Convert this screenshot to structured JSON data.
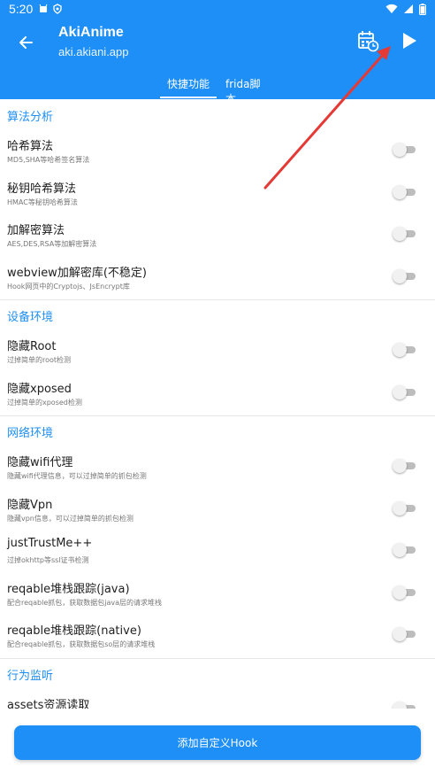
{
  "status_bar": {
    "time": "5:20"
  },
  "app_bar": {
    "title": "AkiAnime",
    "subtitle": "aki.akiani.app"
  },
  "tabs": [
    {
      "label": "快捷功能",
      "selected": true
    },
    {
      "label": "frida脚本",
      "selected": false
    }
  ],
  "sections": [
    {
      "header": "算法分析",
      "items": [
        {
          "title": "哈希算法",
          "desc": "MD5,SHA等哈希签名算法",
          "enabled": false
        },
        {
          "title": "秘钥哈希算法",
          "desc": "HMAC等秘钥哈希算法",
          "enabled": false
        },
        {
          "title": "加解密算法",
          "desc": "AES,DES,RSA等加解密算法",
          "enabled": false
        },
        {
          "title": "webview加解密库(不稳定)",
          "desc": "Hook网页中的Cryptojs、JsEncrypt库",
          "enabled": false
        }
      ]
    },
    {
      "header": "设备环境",
      "items": [
        {
          "title": "隐藏Root",
          "desc": "过掉简单的root检测",
          "enabled": false
        },
        {
          "title": "隐藏xposed",
          "desc": "过掉简单的xposed检测",
          "enabled": false
        }
      ]
    },
    {
      "header": "网络环境",
      "items": [
        {
          "title": "隐藏wifi代理",
          "desc": "隐藏wifi代理信息，可以过掉简单的抓包检测",
          "enabled": false
        },
        {
          "title": "隐藏Vpn",
          "desc": "隐藏vpn信息，可以过掉简单的抓包检测",
          "enabled": false
        },
        {
          "title": "justTrustMe++",
          "desc": "过掉okhttp等ssl证书检测",
          "enabled": false
        },
        {
          "title": "reqable堆栈跟踪(java)",
          "desc": "配合reqable抓包，获取数据包java层的请求堆栈",
          "enabled": false
        },
        {
          "title": "reqable堆栈跟踪(native)",
          "desc": "配合reqable抓包，获取数据包so层的请求堆栈",
          "enabled": false
        }
      ]
    },
    {
      "header": "行为监听",
      "items": [
        {
          "title": "assets资源读取",
          "desc": "",
          "enabled": false
        }
      ]
    }
  ],
  "footer": {
    "add_hook_label": "添加自定义Hook"
  },
  "colors": {
    "primary": "#1e8ff6",
    "annotation_arrow": "#e53935"
  }
}
